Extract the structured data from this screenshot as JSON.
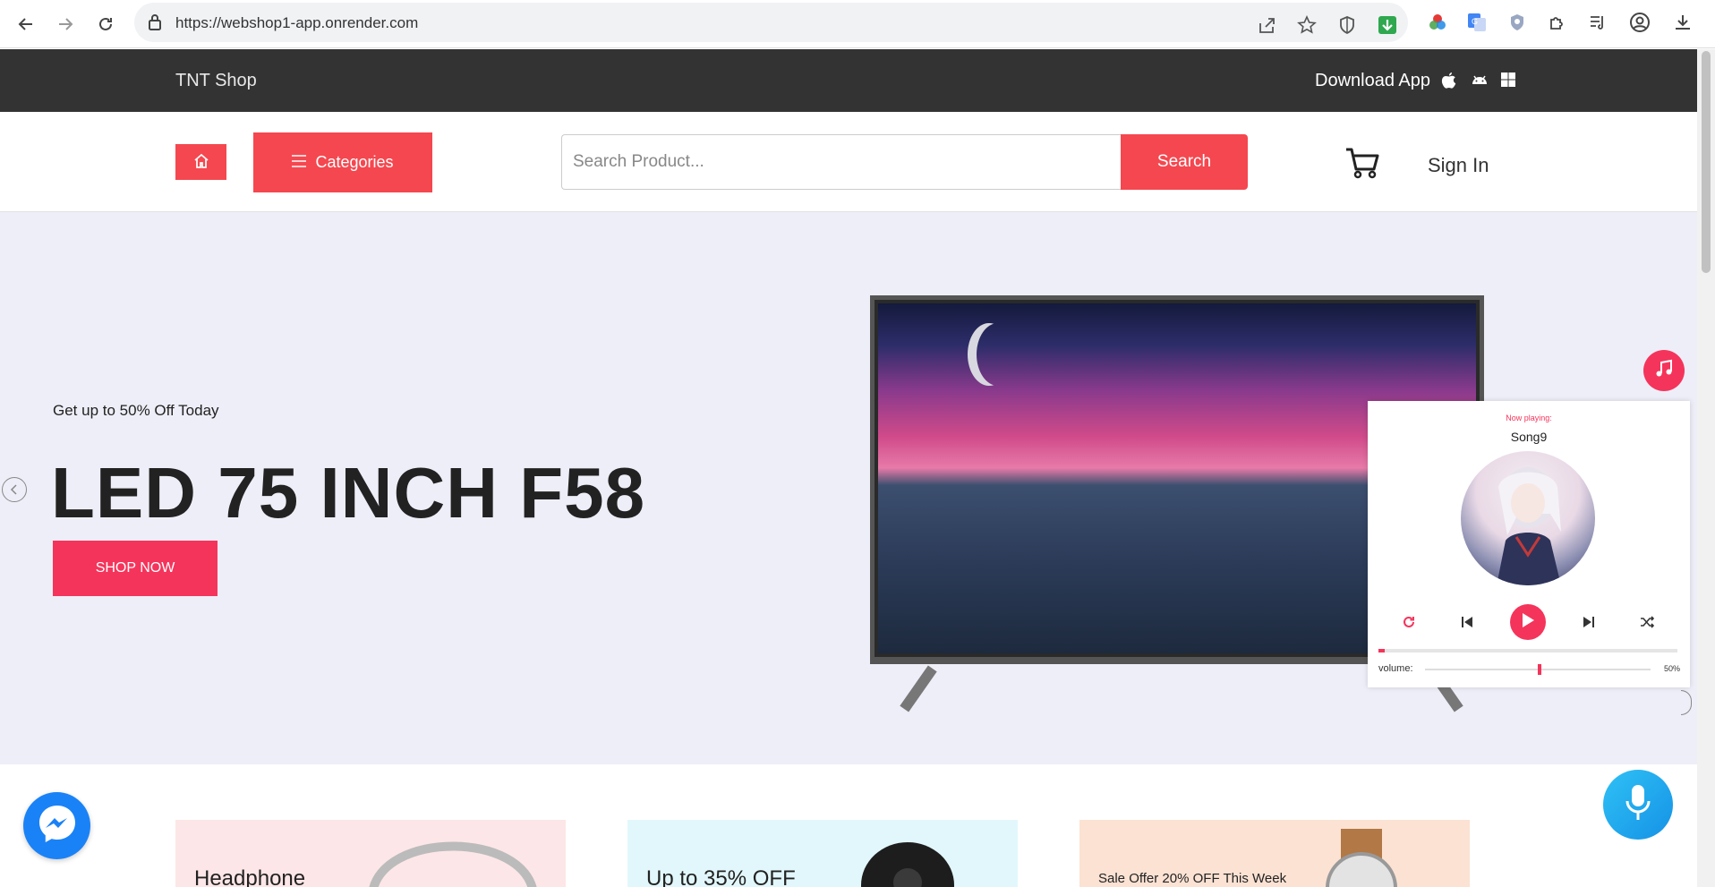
{
  "browser": {
    "url": "https://webshop1-app.onrender.com"
  },
  "topbar": {
    "shop_name": "TNT Shop",
    "download_label": "Download App"
  },
  "header": {
    "categories_label": "Categories",
    "search_placeholder": "Search Product...",
    "search_label": "Search",
    "signin_label": "Sign In"
  },
  "hero": {
    "subtitle": "Get up to 50% Off Today",
    "title": "LED 75 INCH F58",
    "cta_label": "SHOP NOW"
  },
  "player": {
    "now_playing_label": "Now playing:",
    "song": "Song9",
    "volume_label": "volume:",
    "volume_value": "50%",
    "volume_level": 0.5,
    "progress": 0.02
  },
  "cards": [
    {
      "title": "Headphone",
      "bg": "#fde6e7"
    },
    {
      "title": "Up to 35% OFF",
      "bg": "#e2f7fb"
    },
    {
      "title": "Sale Offer 20% OFF This Week",
      "bg": "#fbe2d3"
    }
  ],
  "colors": {
    "accent": "#f5474f",
    "accent_pink": "#f5345b",
    "topbar": "#333333",
    "hero_bg": "#eeeef8"
  }
}
